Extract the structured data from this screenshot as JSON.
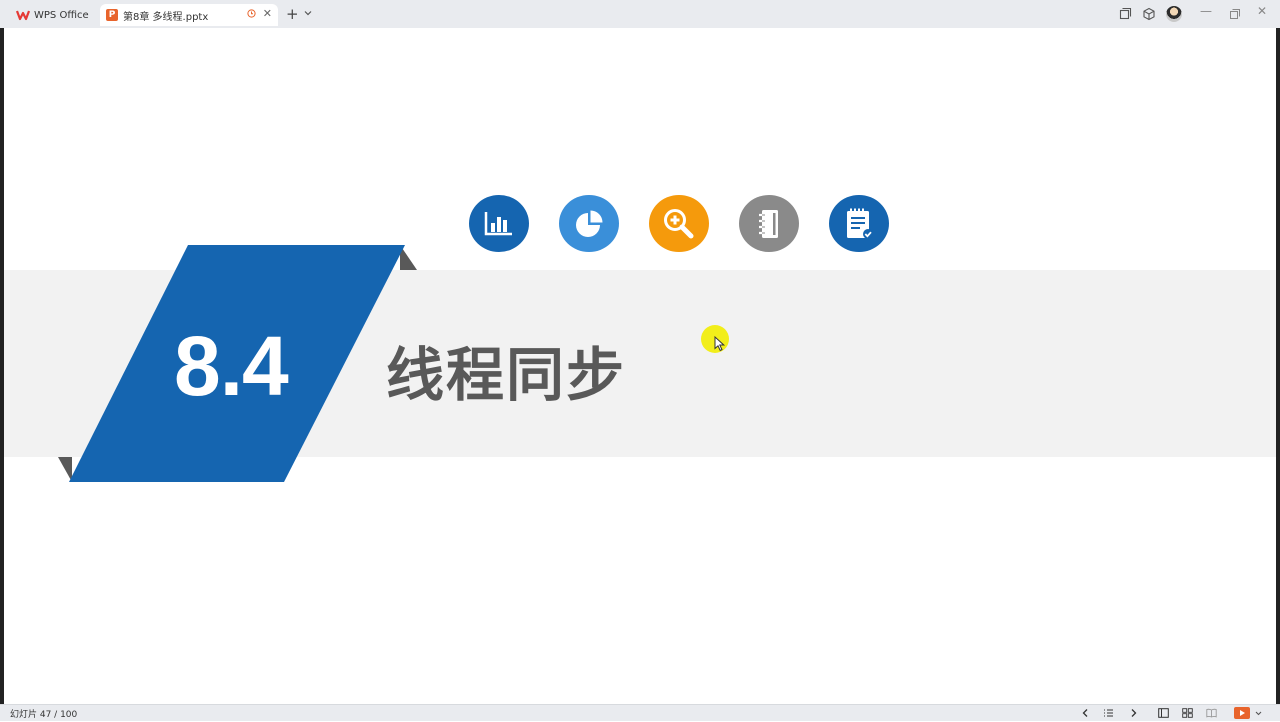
{
  "tabs": [
    {
      "label": "WPS Office"
    },
    {
      "label": "第8章 多线程.pptx"
    }
  ],
  "window": {
    "new_tab_label": "+"
  },
  "slide": {
    "section_number": "8.4",
    "title": "线程同步",
    "icons": [
      "bar-chart-icon",
      "pie-chart-icon",
      "zoom-in-icon",
      "notebook-icon",
      "checklist-icon"
    ]
  },
  "status": {
    "slide_counter": "幻灯片 47 / 100"
  },
  "colors": {
    "accent_blue": "#1565b0",
    "light_blue": "#3a8fd9",
    "orange": "#f59a0c",
    "gray": "#8a8a8a",
    "band": "#f2f2f2",
    "title_gray": "#595959"
  }
}
